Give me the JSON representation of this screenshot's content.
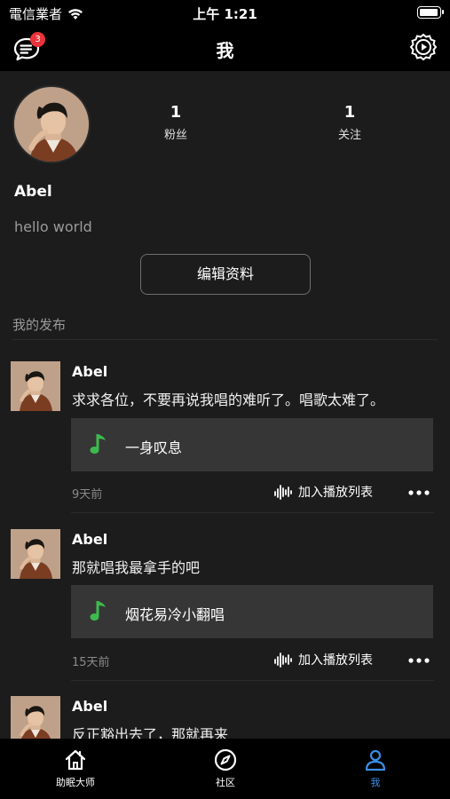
{
  "status_bar": {
    "carrier": "電信業者",
    "time": "上午 1:21",
    "battery_level": 1.0
  },
  "nav": {
    "title": "我",
    "message_badge": "3"
  },
  "profile": {
    "followers_count": "1",
    "followers_label": "粉丝",
    "following_count": "1",
    "following_label": "关注",
    "username": "Abel",
    "bio": "hello world",
    "edit_button": "编辑资料"
  },
  "section_title": "我的发布",
  "posts": [
    {
      "author": "Abel",
      "text": "求求各位，不要再说我唱的难听了。唱歌太难了。",
      "song": "一身叹息",
      "time": "9天前",
      "add_playlist": "加入播放列表"
    },
    {
      "author": "Abel",
      "text": "那就唱我最拿手的吧",
      "song": "烟花易冷小翻唱",
      "time": "15天前",
      "add_playlist": "加入播放列表"
    },
    {
      "author": "Abel",
      "text": "反正豁出去了，那就再来"
    }
  ],
  "tabs": [
    {
      "label": "助眠大师",
      "icon": "home-icon"
    },
    {
      "label": "社区",
      "icon": "compass-icon"
    },
    {
      "label": "我",
      "icon": "person-icon",
      "active": true
    }
  ],
  "colors": {
    "accent": "#3a8ee6",
    "note_green": "#3dba4e",
    "badge_red": "#e8343a",
    "background": "#1c1c1c",
    "card": "#363636"
  }
}
